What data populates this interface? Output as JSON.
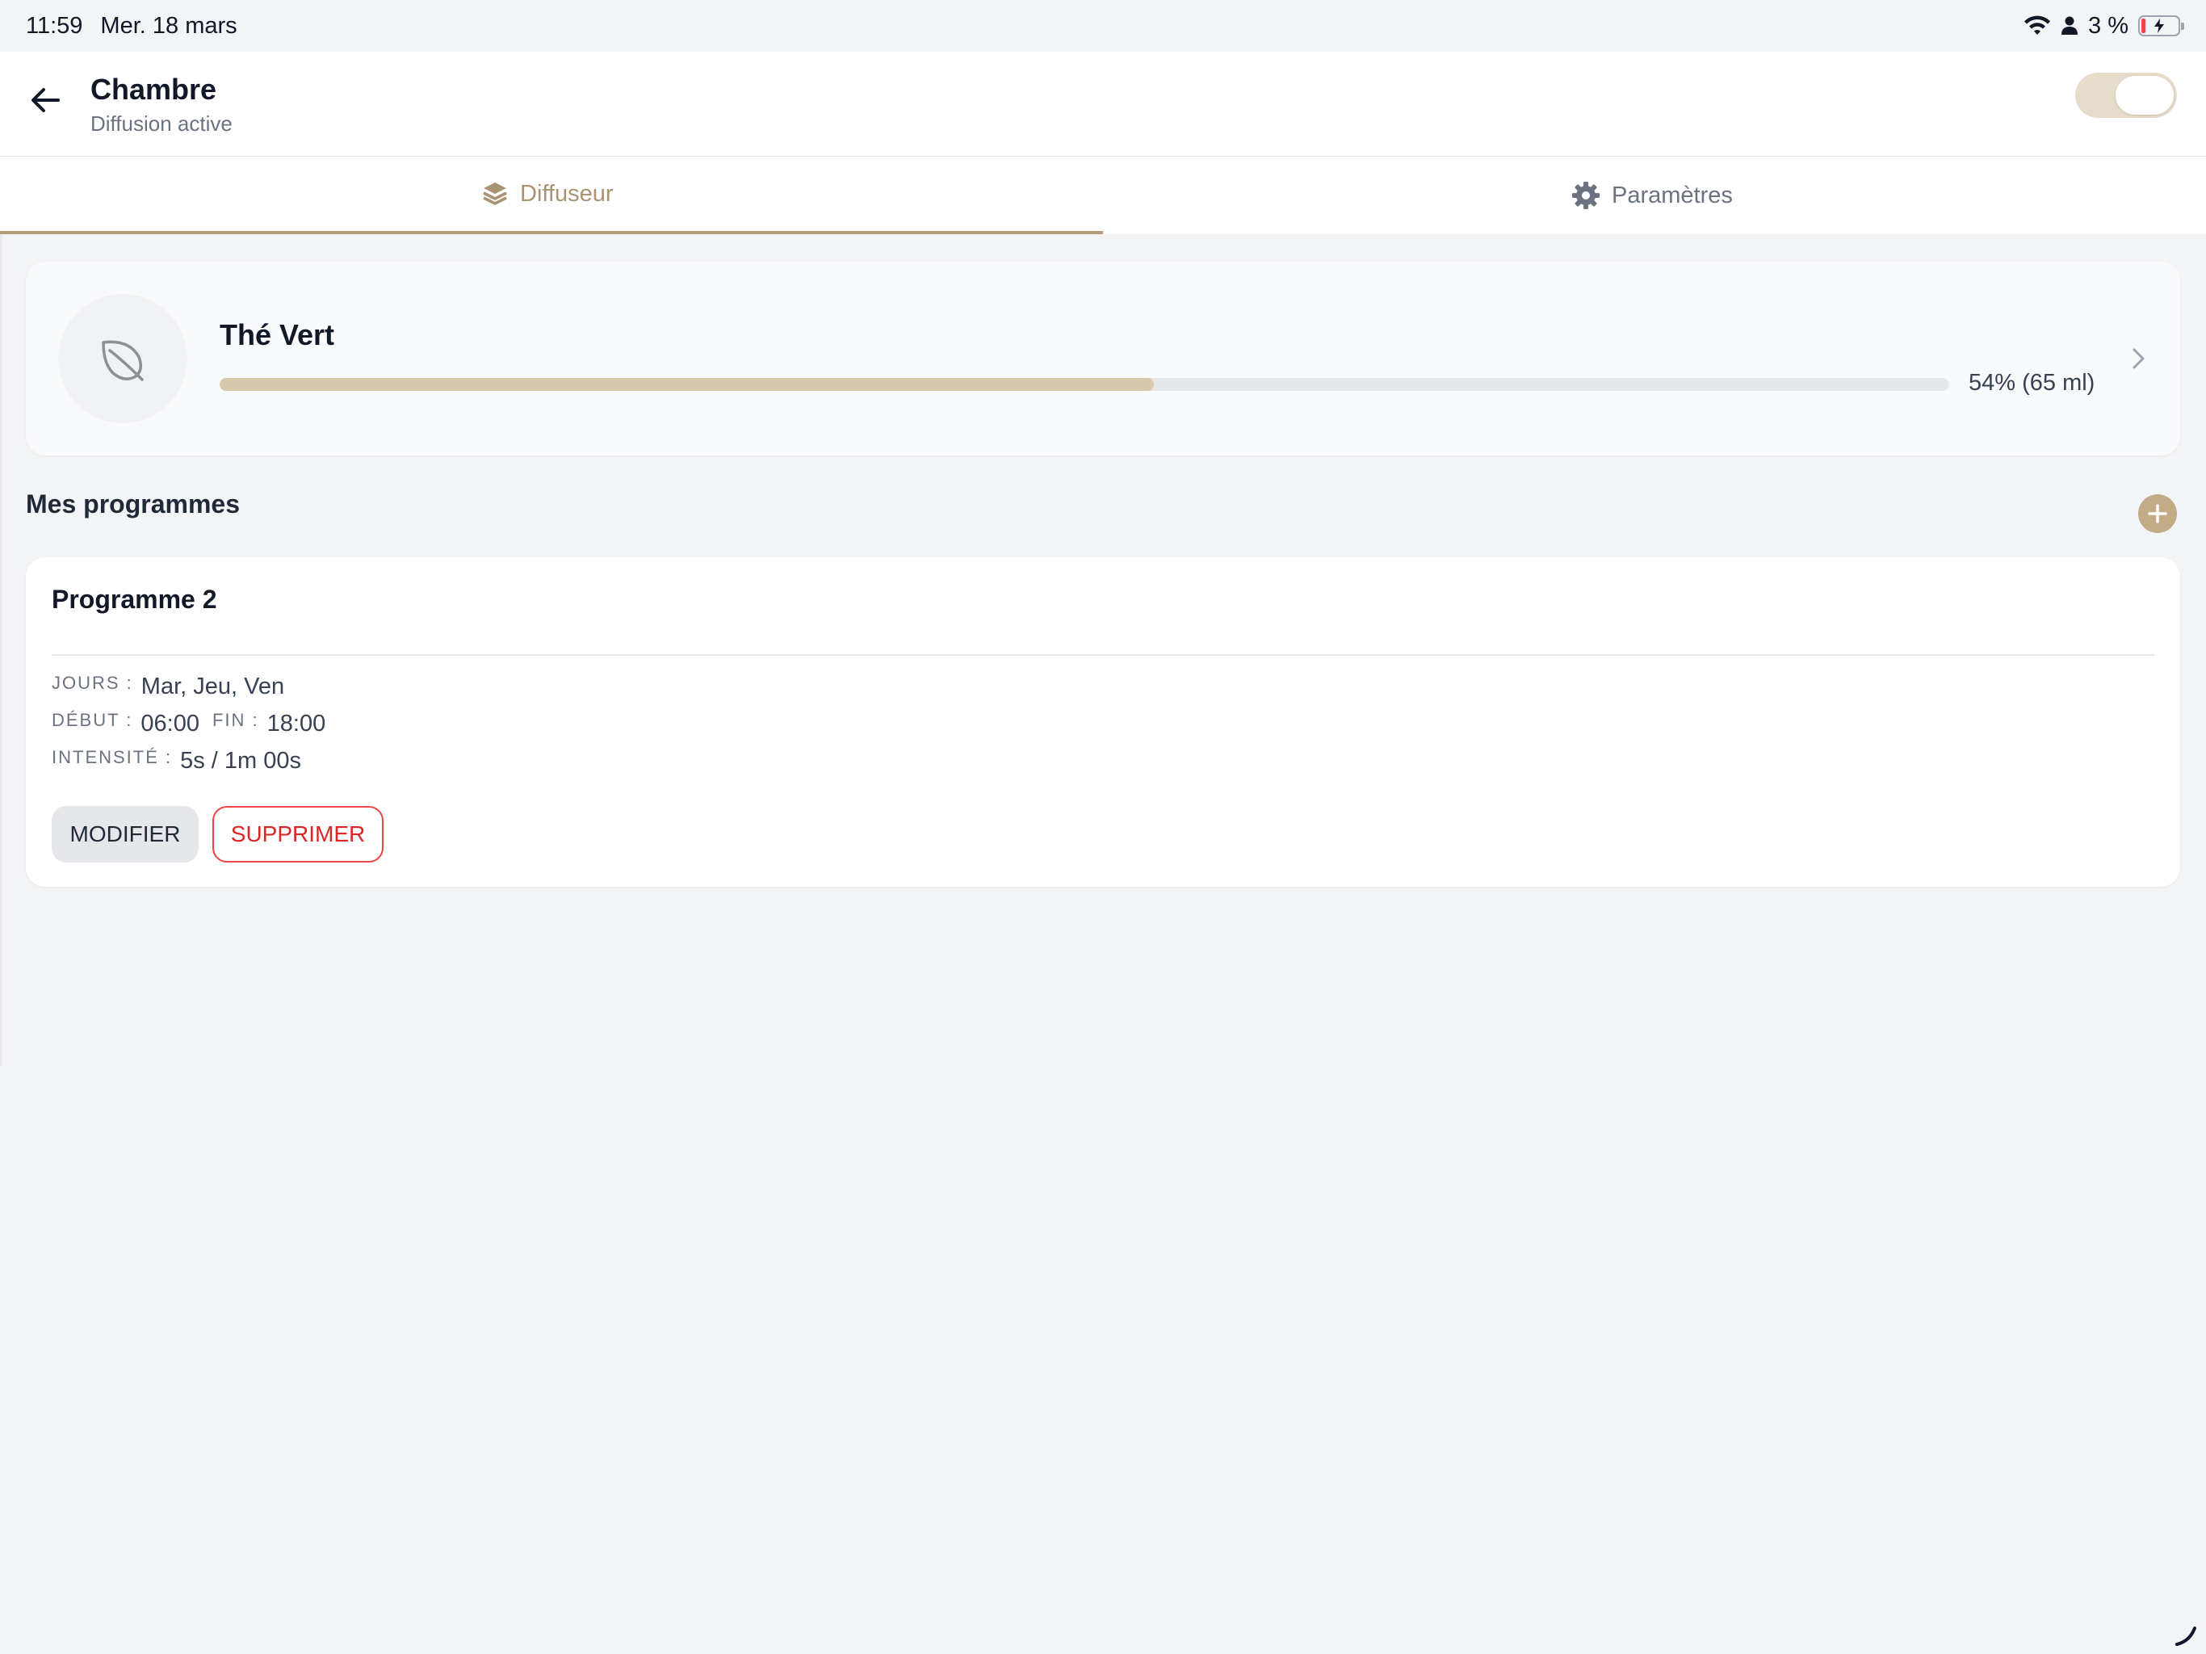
{
  "status_bar": {
    "time": "11:59",
    "date": "Mer. 18 mars",
    "battery_percent": "3 %",
    "icons": [
      "wifi-icon",
      "person-icon",
      "battery-charging-icon"
    ]
  },
  "header": {
    "title": "Chambre",
    "subtitle": "Diffusion active",
    "toggle_on": true
  },
  "tabs": [
    {
      "label": "Diffuseur",
      "icon": "layers-icon",
      "active": true
    },
    {
      "label": "Paramètres",
      "icon": "gear-icon",
      "active": false
    }
  ],
  "product": {
    "name": "Thé Vert",
    "icon": "leaf-icon",
    "level_percent": 54,
    "level_label": "54% (65 ml)"
  },
  "programs_section": {
    "title": "Mes programmes"
  },
  "program": {
    "name": "Programme 2",
    "days_label": "JOURS :",
    "days_value": "Mar, Jeu, Ven",
    "start_label": "DÉBUT :",
    "start_value": "06:00",
    "end_label": "FIN :",
    "end_value": "18:00",
    "intensity_label": "INTENSITÉ :",
    "intensity_value": "5s / 1m 00s",
    "modify_label": "MODIFIER",
    "delete_label": "SUPPRIMER"
  },
  "colors": {
    "accent": "#b29c7c",
    "progress_fill": "#d8c8ae",
    "danger": "#dc2626",
    "background": "#f3f4f6"
  }
}
